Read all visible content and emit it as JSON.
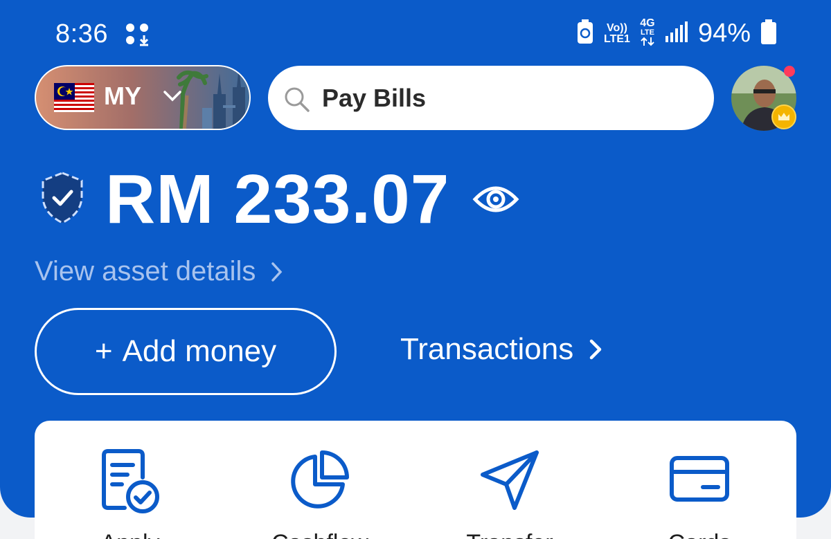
{
  "status_bar": {
    "time": "8:36",
    "network_top": "Vo))",
    "network_bottom": "LTE1",
    "network_gen": "4G",
    "network_gen_sub": "LTE",
    "battery_percent": "94%"
  },
  "header": {
    "region_code": "MY",
    "search_placeholder": "Pay Bills"
  },
  "balance": {
    "currency": "RM",
    "amount": "233.07",
    "asset_link": "View asset details"
  },
  "buttons": {
    "add_money": "Add money",
    "add_money_plus": "+",
    "transactions": "Transactions"
  },
  "quick_actions": [
    {
      "label": "Apply",
      "icon": "document-check-icon"
    },
    {
      "label": "Cashflow",
      "icon": "pie-chart-icon"
    },
    {
      "label": "Transfer",
      "icon": "send-icon"
    },
    {
      "label": "Cards",
      "icon": "card-icon"
    }
  ],
  "colors": {
    "brand_blue": "#0b5bc9",
    "link_blue": "#a8c3ee",
    "notification": "#ff3b5c",
    "crown": "#f4b400"
  }
}
